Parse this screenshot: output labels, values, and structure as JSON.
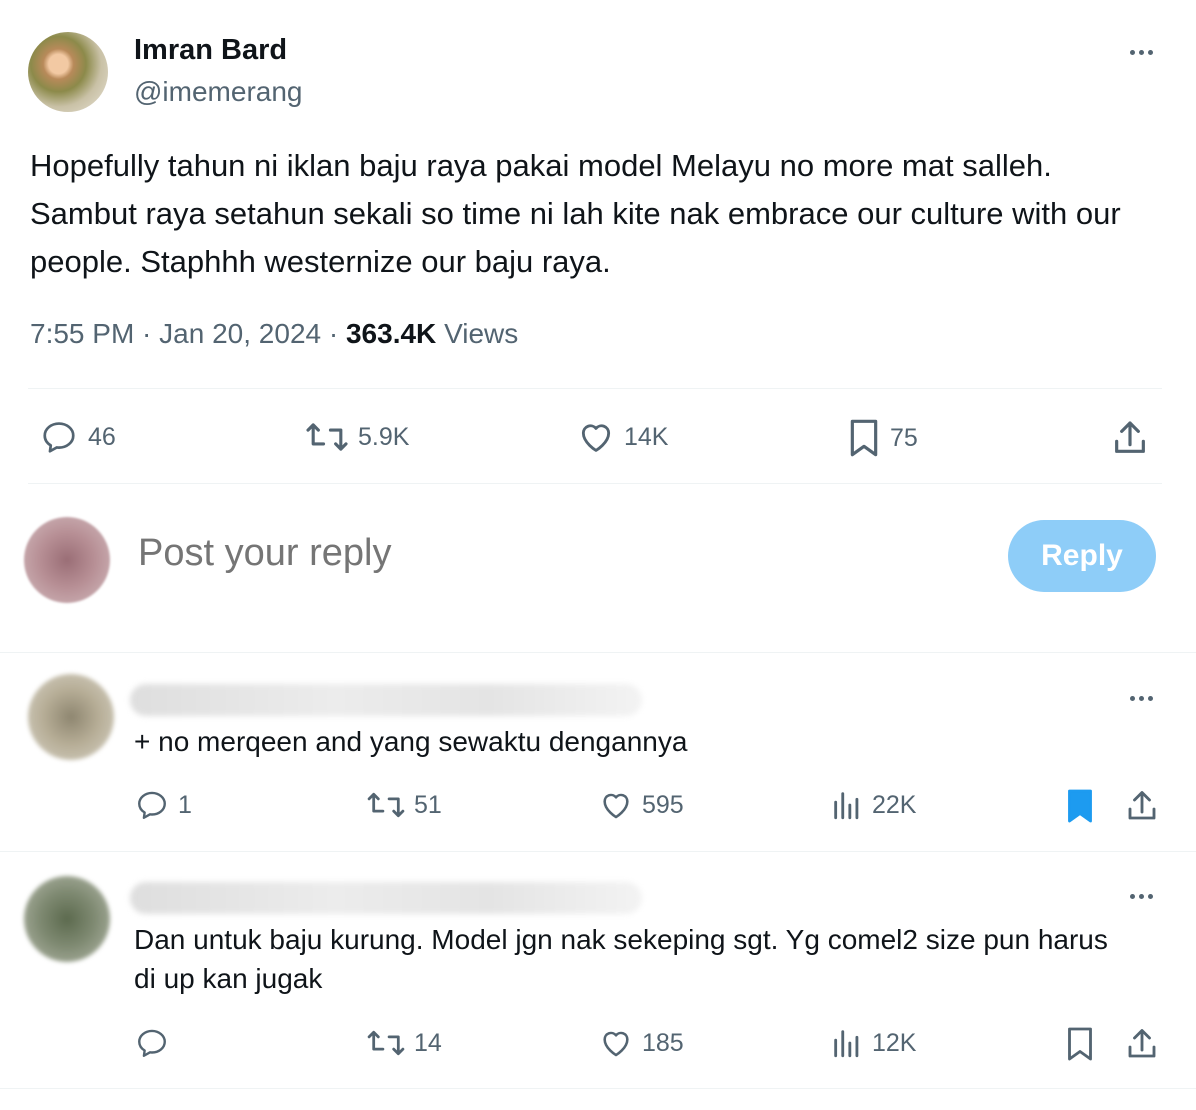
{
  "tweet": {
    "author_name": "Imran Bard",
    "author_handle": "@imemerang",
    "text": "Hopefully tahun ni iklan baju raya pakai model Melayu no more mat salleh. Sambut raya setahun sekali so time ni lah kite nak embrace our culture with our people. Staphhh westernize our baju raya.",
    "time": "7:55 PM",
    "date": "Jan 20, 2024",
    "views_count": "363.4K",
    "views_label": "Views",
    "stats": {
      "replies": "46",
      "reposts": "5.9K",
      "likes": "14K",
      "bookmarks": "75"
    }
  },
  "composer": {
    "placeholder": "Post your reply",
    "button_label": "Reply"
  },
  "replies": [
    {
      "text": "+ no merqeen and yang sewaktu dengannya",
      "stats": {
        "replies": "1",
        "reposts": "51",
        "likes": "595",
        "views": "22K"
      },
      "bookmarked": true
    },
    {
      "text": "Dan untuk baju kurung. Model jgn nak sekeping sgt. Yg comel2 size pun harus di up kan jugak",
      "stats": {
        "replies": "",
        "reposts": "14",
        "likes": "185",
        "views": "12K"
      },
      "bookmarked": false
    }
  ],
  "colors": {
    "text": "#0f1419",
    "muted": "#536471",
    "accent": "#1d9bf0",
    "reply_button_disabled": "#8ecdf8",
    "divider": "#eff3f4"
  },
  "icons": [
    "more-icon",
    "reply-icon",
    "repost-icon",
    "like-icon",
    "bookmark-icon",
    "share-icon",
    "views-icon"
  ]
}
